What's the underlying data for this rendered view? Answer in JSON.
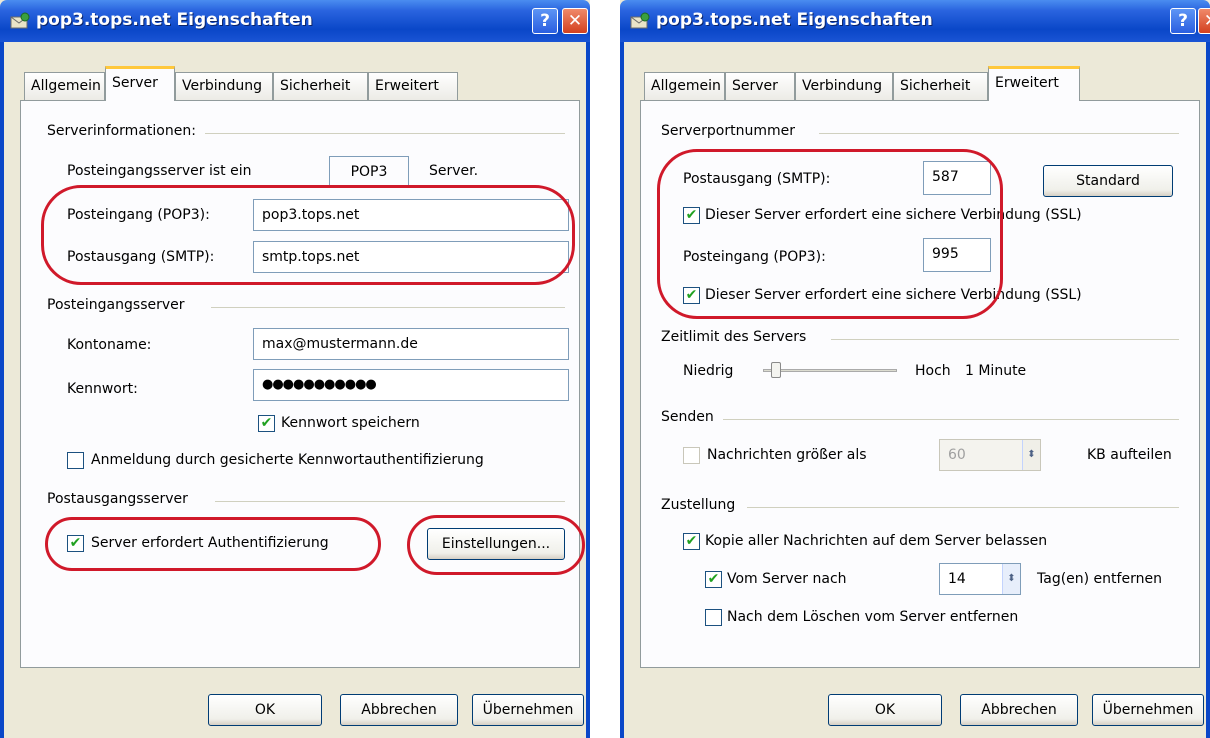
{
  "left_dialog": {
    "title": "pop3.tops.net Eigenschaften",
    "tabs": [
      "Allgemein",
      "Server",
      "Verbindung",
      "Sicherheit",
      "Erweitert"
    ],
    "active_tab": "Server",
    "server_info_heading": "Serverinformationen:",
    "incoming_type_label": "Posteingangsserver ist ein",
    "incoming_type_value": "POP3",
    "incoming_type_suffix": "Server.",
    "pop3_label": "Posteingang (POP3):",
    "pop3_value": "pop3.tops.net",
    "smtp_label": "Postausgang (SMTP):",
    "smtp_value": "smtp.tops.net",
    "incoming_server_heading": "Posteingangsserver",
    "account_label": "Kontoname:",
    "account_value": "max@mustermann.de",
    "password_label": "Kennwort:",
    "password_value": "●●●●●●●●●●●",
    "save_password_label": "Kennwort speichern",
    "save_password_checked": true,
    "spa_label": "Anmeldung durch gesicherte Kennwortauthentifizierung",
    "spa_checked": false,
    "outgoing_server_heading": "Postausgangsserver",
    "auth_label": "Server erfordert Authentifizierung",
    "auth_checked": true,
    "settings_button": "Einstellungen...",
    "ok_button": "OK",
    "cancel_button": "Abbrechen",
    "apply_button": "Übernehmen"
  },
  "right_dialog": {
    "title": "pop3.tops.net Eigenschaften",
    "tabs": [
      "Allgemein",
      "Server",
      "Verbindung",
      "Sicherheit",
      "Erweitert"
    ],
    "active_tab": "Erweitert",
    "port_heading": "Serverportnummer",
    "smtp_label": "Postausgang (SMTP):",
    "smtp_port": "587",
    "standard_button": "Standard",
    "smtp_ssl_label": "Dieser Server erfordert eine sichere Verbindung (SSL)",
    "smtp_ssl_checked": true,
    "pop3_label": "Posteingang (POP3):",
    "pop3_port": "995",
    "pop3_ssl_label": "Dieser Server erfordert eine sichere Verbindung (SSL)",
    "pop3_ssl_checked": true,
    "timeout_heading": "Zeitlimit des Servers",
    "timeout_low": "Niedrig",
    "timeout_high": "Hoch",
    "timeout_value": "1 Minute",
    "timeout_level": 0.1,
    "send_heading": "Senden",
    "split_label": "Nachrichten größer als",
    "split_checked": false,
    "split_value": "60",
    "split_unit": "KB aufteilen",
    "delivery_heading": "Zustellung",
    "keep_copy_label": "Kopie aller Nachrichten auf dem Server belassen",
    "keep_copy_checked": true,
    "remove_after_label": "Vom Server nach",
    "remove_after_checked": true,
    "remove_after_days": "14",
    "remove_after_unit": "Tag(en) entfernen",
    "remove_on_delete_label": "Nach dem Löschen vom Server entfernen",
    "remove_on_delete_checked": false,
    "ok_button": "OK",
    "cancel_button": "Abbrechen",
    "apply_button": "Übernehmen"
  },
  "colors": {
    "annotation_red": "#d0192a",
    "title_blue": "#0a47c8",
    "dialog_bg": "#ece9d8"
  }
}
